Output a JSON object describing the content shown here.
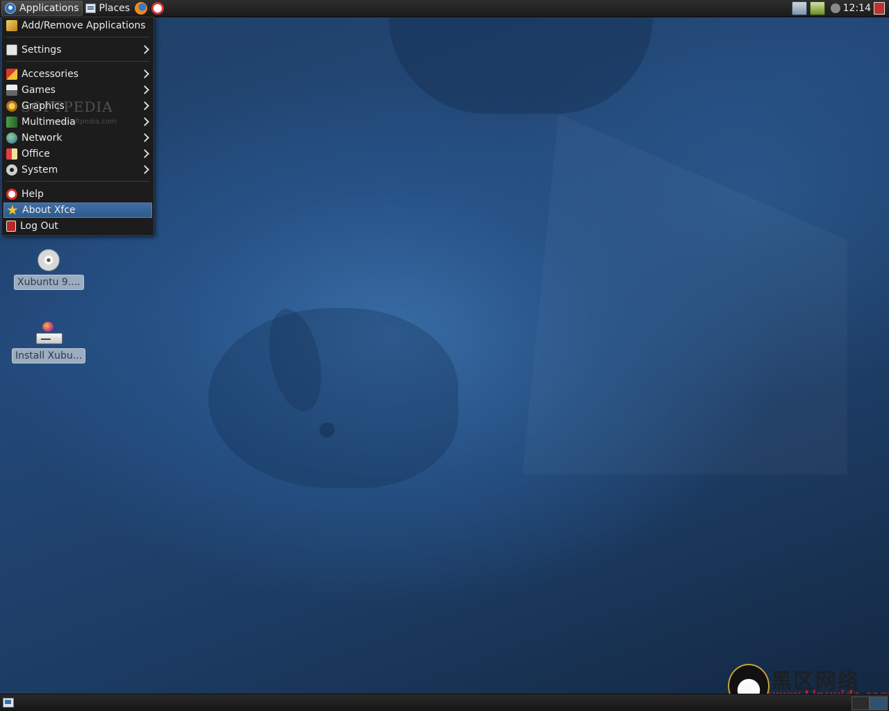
{
  "top_panel": {
    "applications_label": "Applications",
    "places_label": "Places",
    "clock": "12:14"
  },
  "app_menu": {
    "items": [
      {
        "label": "Add/Remove Applications",
        "icon": "add-remove-applications-icon",
        "submenu": false
      },
      {
        "label": "Settings",
        "icon": "settings-icon",
        "submenu": true
      },
      {
        "label": "Accessories",
        "icon": "accessories-icon",
        "submenu": true
      },
      {
        "label": "Games",
        "icon": "games-icon",
        "submenu": true
      },
      {
        "label": "Graphics",
        "icon": "graphics-icon",
        "submenu": true
      },
      {
        "label": "Multimedia",
        "icon": "multimedia-icon",
        "submenu": true
      },
      {
        "label": "Network",
        "icon": "network-icon",
        "submenu": true
      },
      {
        "label": "Office",
        "icon": "office-icon",
        "submenu": true
      },
      {
        "label": "System",
        "icon": "system-icon",
        "submenu": true
      },
      {
        "label": "Help",
        "icon": "help-icon",
        "submenu": false
      },
      {
        "label": "About Xfce",
        "icon": "about-star-icon",
        "submenu": false,
        "highlighted": true
      },
      {
        "label": "Log Out",
        "icon": "log-out-icon",
        "submenu": false
      }
    ]
  },
  "desktop_icons": [
    {
      "label": "Xubuntu 9....",
      "icon": "cd-disc-icon"
    },
    {
      "label": "Install Xubu...",
      "icon": "installer-icon"
    }
  ],
  "watermarks": {
    "softpedia": "SOFTPEDIA",
    "softpedia_sub": "www.softpedia.com",
    "linuxidc_cn": "黑区网络",
    "linuxidc_url": "www.Linuxidc.com"
  },
  "colors": {
    "panel": "#1f1f1f",
    "menu_background": "#1c1c1c",
    "menu_highlight": "#2f5a8c",
    "wallpaper": "#23497a"
  }
}
